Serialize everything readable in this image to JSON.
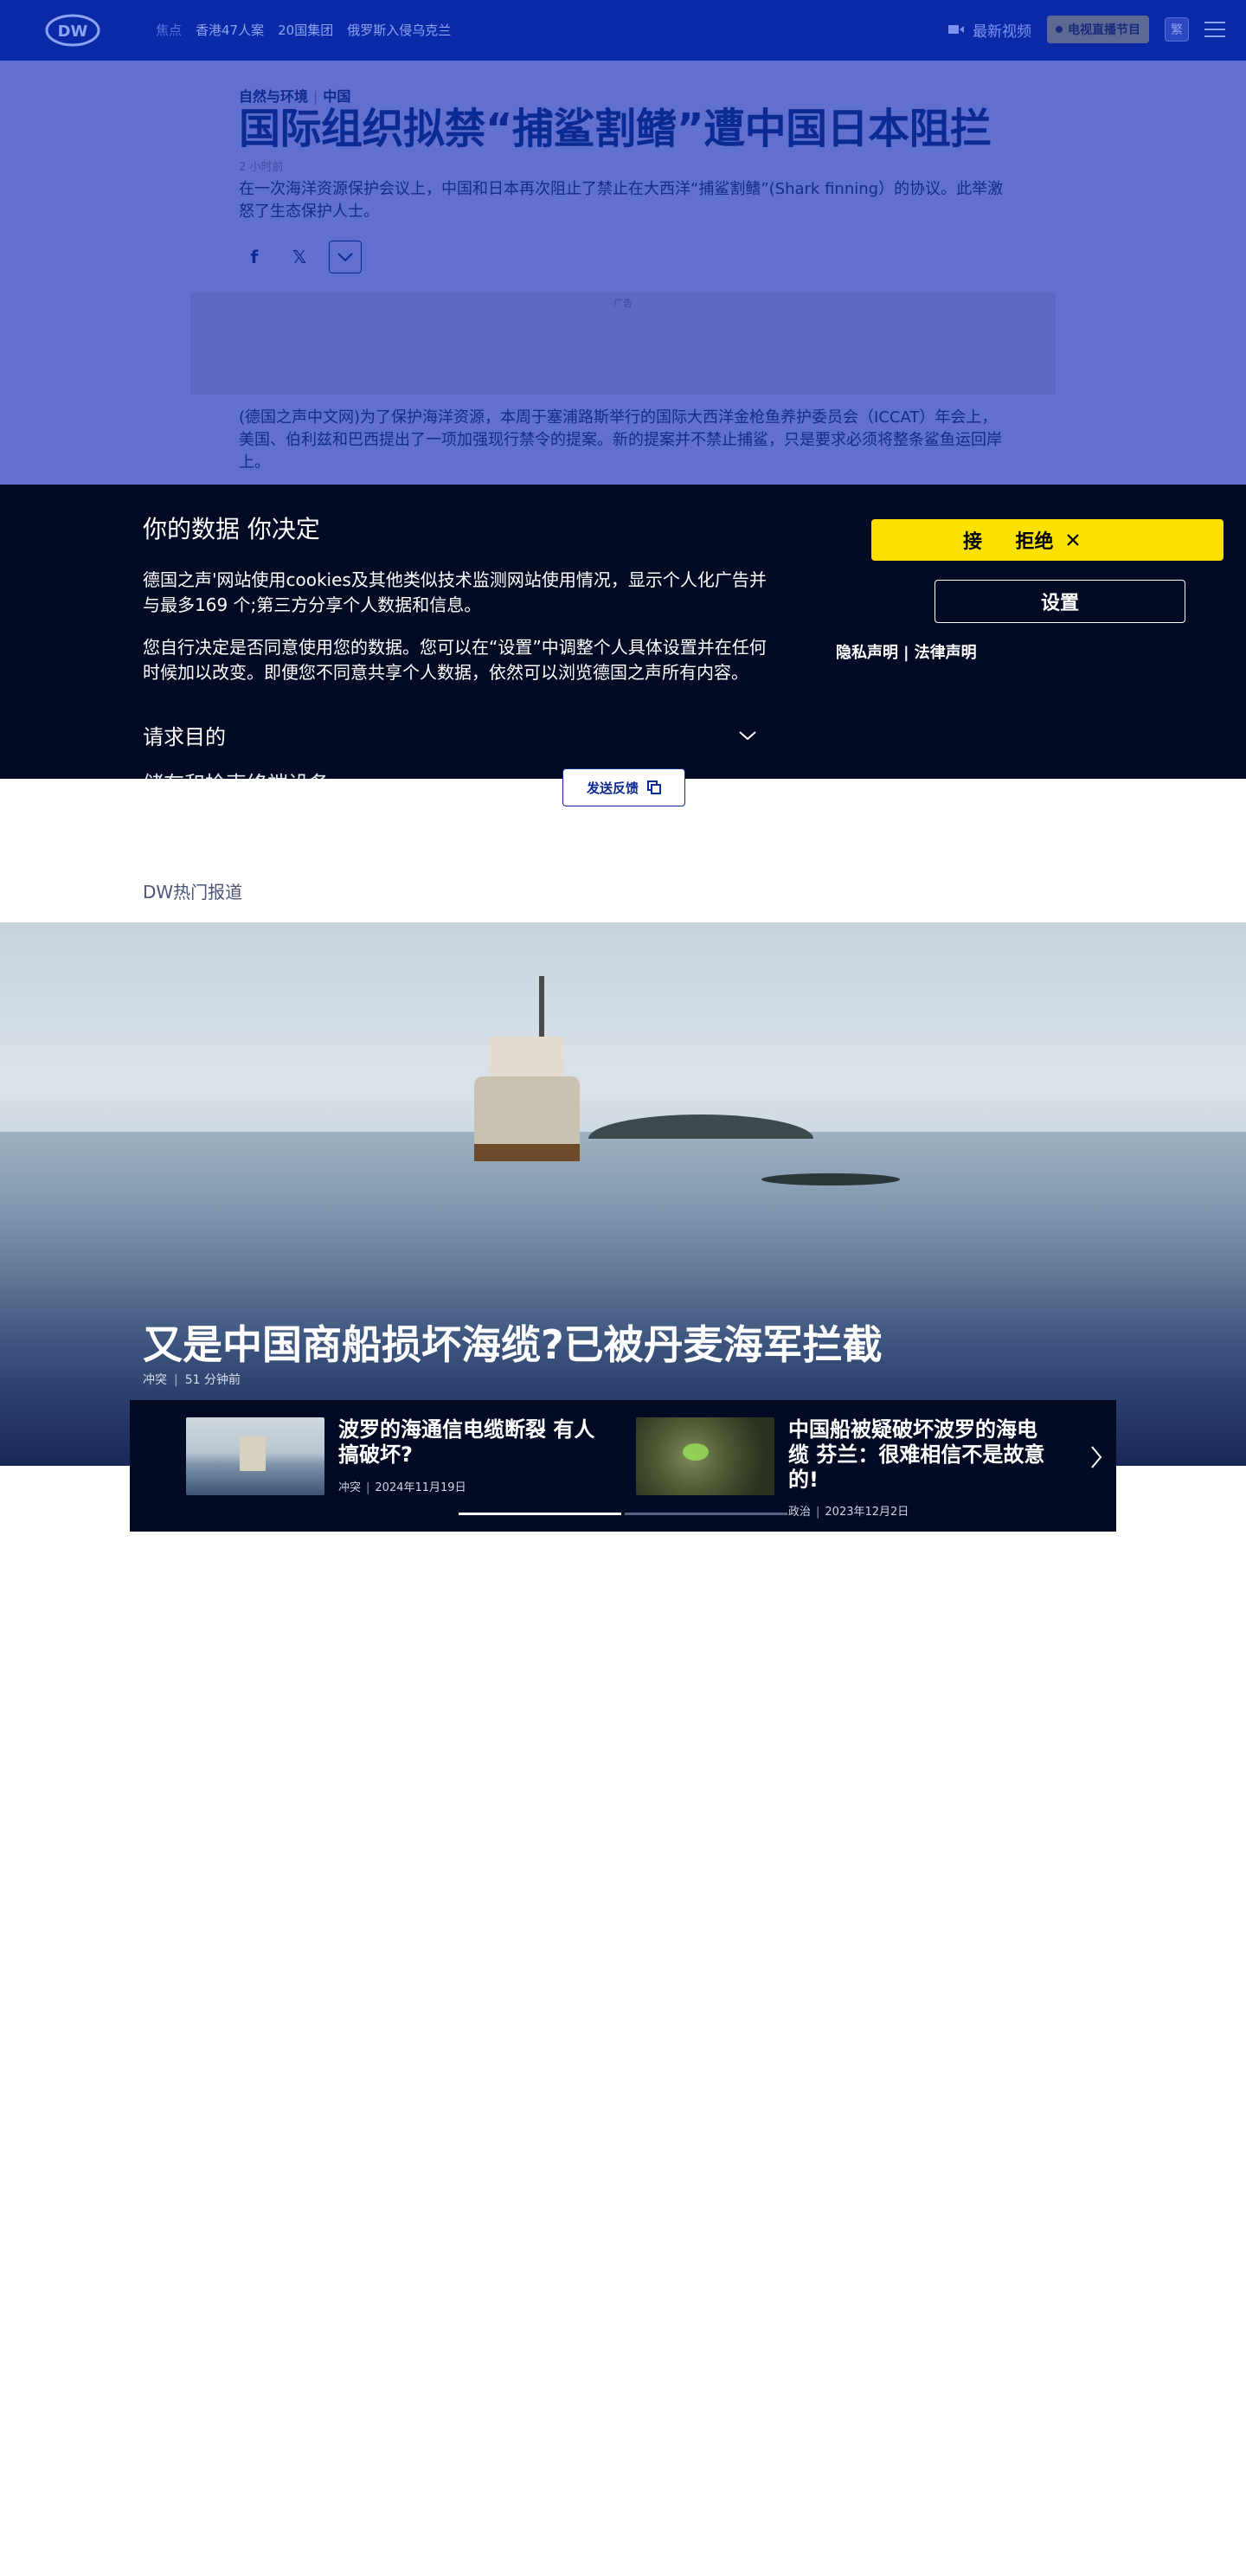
{
  "header": {
    "logo_text": "DW",
    "nav": [
      "焦点",
      "香港47人案",
      "20国集团",
      "俄罗斯入侵乌克兰"
    ],
    "latest_video": "最新视频",
    "live_tv": "电视直播节目",
    "lang_button": "繁",
    "colors": {
      "bg": "#0a2aa8"
    }
  },
  "article": {
    "kicker_left": "自然与环境",
    "kicker_right": "中国",
    "title": "国际组织拟禁“捕鲨割鳍”遭中国日本阻拦",
    "time": "2 小时前",
    "lead": "在一次海洋资源保护会议上，中国和日本再次阻止了禁止在大西洋“捕鲨割鳍”(Shark finning）的协议。此举激怒了生态保护人士。",
    "share_icons": [
      "facebook-icon",
      "x-icon",
      "chevron-down-icon"
    ],
    "ad_label": "广告",
    "body": "(德国之声中文网)为了保护海洋资源，本周于塞浦路斯举行的国际大西洋金枪鱼养护委员会（ICCAT）年会上，美国、伯利兹和巴西提出了一项加强现行禁令的提案。新的提案并不禁止捕鲨，只是要求必须将整条鲨鱼运回岸上。"
  },
  "cookie": {
    "title": "你的数据 你决定",
    "p1": "德国之声'网站使用cookies及其他类似技术监测网站使用情况，显示个人化广告并与最多169 个;第三方分享个人数据和信息。",
    "p2": "您自行决定是否同意使用您的数据。您可以在“设置”中调整个人具体设置并在任何时候加以改变。即便您不同意共享个人数据，依然可以浏览德国之声所有内容。",
    "purpose": "请求目的",
    "next_section": "储存和检索终端设备",
    "reject_prefix": "接",
    "reject": "拒绝",
    "settings": "设置",
    "privacy": "隐私声明",
    "legal": "法律声明",
    "colors": {
      "bg": "#020a24",
      "reject_bg": "#fbe100"
    }
  },
  "feedback": {
    "label": "发送反馈"
  },
  "section": {
    "label": "DW热门报道"
  },
  "hero": {
    "headline": "又是中国商船损坏海缆?已被丹麦海军拦截",
    "category": "冲突",
    "time": "51 分钟前"
  },
  "carousel": {
    "items": [
      {
        "title": "波罗的海通信电缆断裂 有人搞破坏?",
        "category": "冲突",
        "date": "2024年11月19日"
      },
      {
        "title": "中国船被疑破坏波罗的海电缆 芬兰：很难相信不是故意的!",
        "category": "政治",
        "date": "2023年12月2日"
      }
    ],
    "next_icon": "chevron-right-icon",
    "active_index": 1,
    "total": 2
  }
}
